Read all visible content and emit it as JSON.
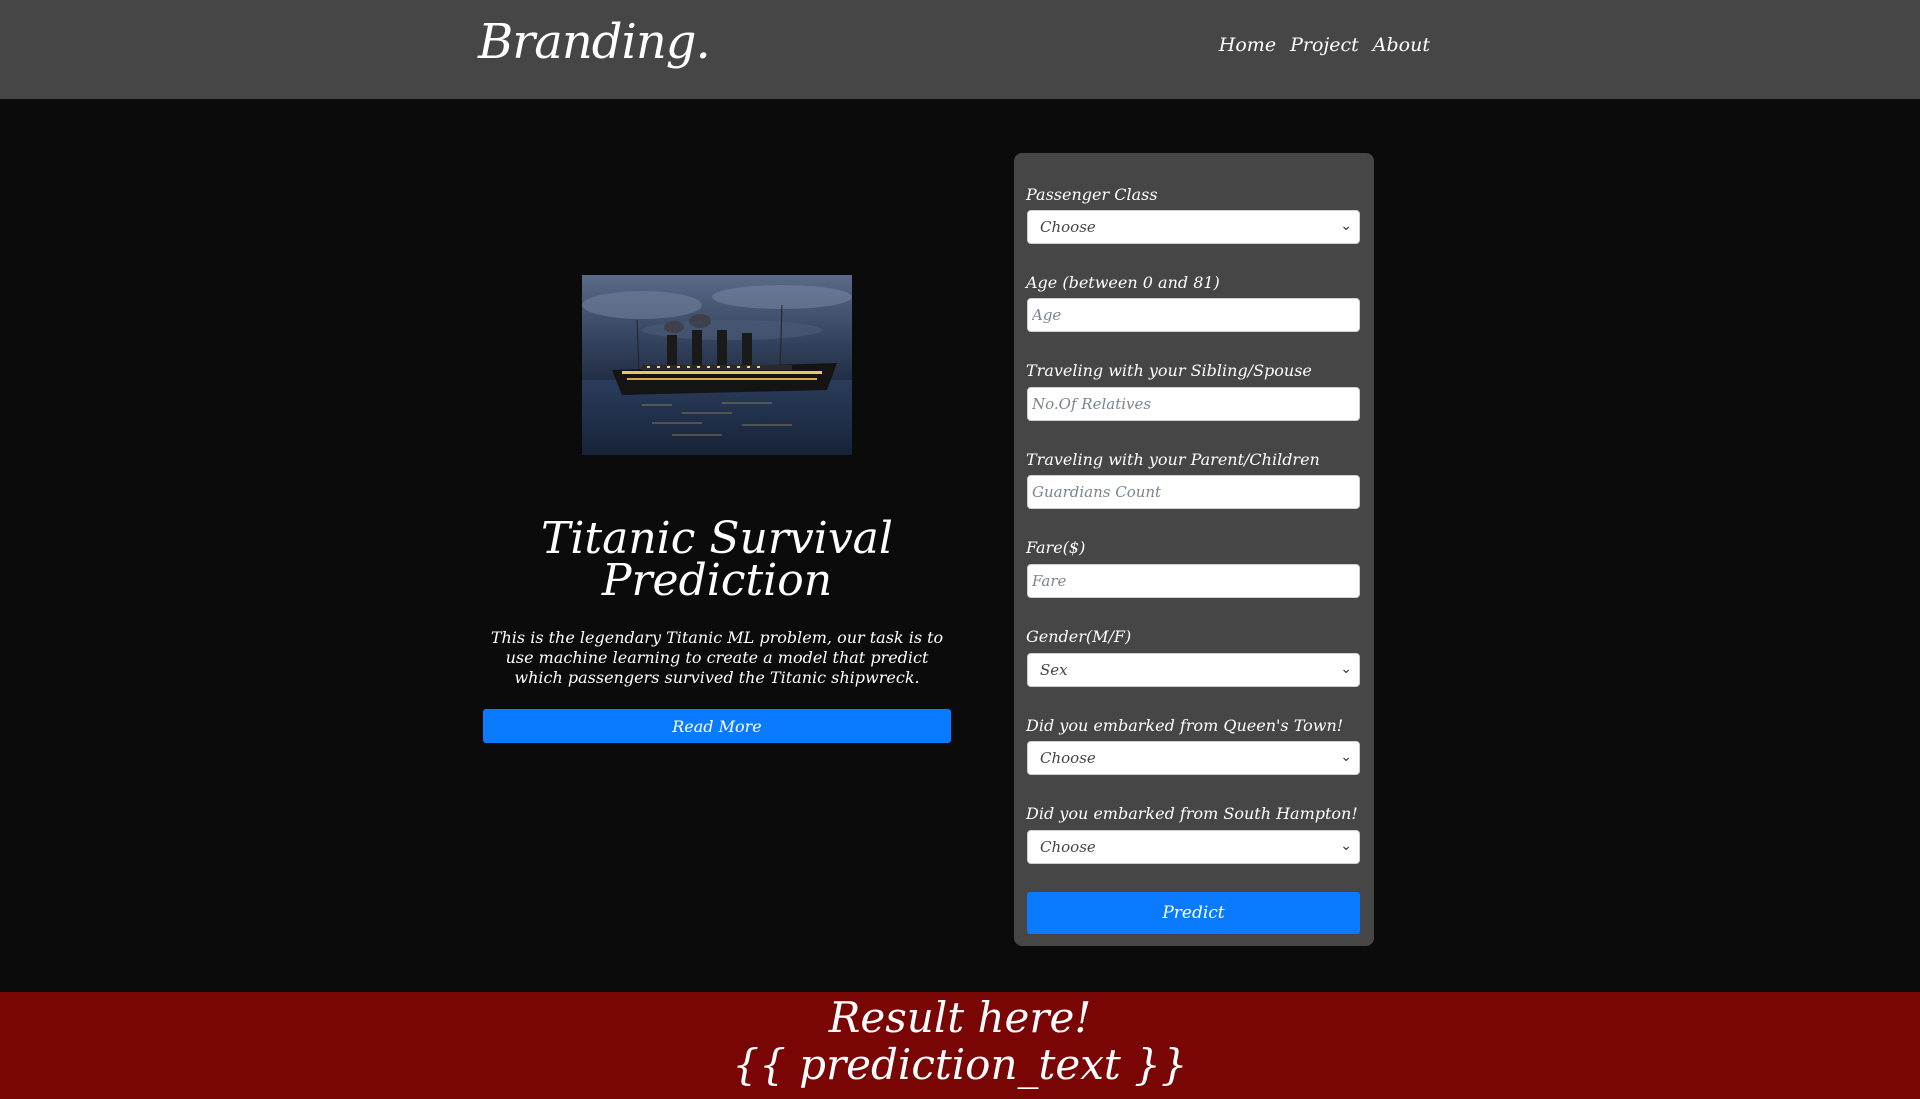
{
  "navbar": {
    "brand": "Branding.",
    "links": [
      "Home",
      "Project",
      "About"
    ]
  },
  "hero": {
    "image_alt": "Titanic ship at night",
    "title_line1": "Titanic Survival",
    "title_line2": "Prediction",
    "description": "This is the legendary Titanic ML problem, our task is to use machine learning to create a model that predict which passengers survived the Titanic shipwreck.",
    "read_more_label": "Read More"
  },
  "form": {
    "fields": [
      {
        "label": "Passenger Class",
        "type": "select",
        "value": "Choose"
      },
      {
        "label": "Age (between 0 and 81)",
        "type": "input",
        "placeholder": "Age"
      },
      {
        "label": "Traveling with your Sibling/Spouse",
        "type": "input",
        "placeholder": "No.Of Relatives"
      },
      {
        "label": "Traveling with your Parent/Children",
        "type": "input",
        "placeholder": "Guardians Count"
      },
      {
        "label": "Fare($)",
        "type": "input",
        "placeholder": "Fare"
      },
      {
        "label": "Gender(M/F)",
        "type": "select",
        "value": "Sex"
      },
      {
        "label": "Did you embarked from Queen's Town!",
        "type": "select",
        "value": "Choose"
      },
      {
        "label": "Did you embarked from South Hampton!",
        "type": "select",
        "value": "Choose"
      }
    ],
    "predict_label": "Predict"
  },
  "result": {
    "line1": "Result here!",
    "line2": "{{ prediction_text }}"
  },
  "colors": {
    "navbar": "#464646",
    "background": "#0b0b0b",
    "accent": "#0a7bff",
    "result_bar": "#7a0505"
  }
}
